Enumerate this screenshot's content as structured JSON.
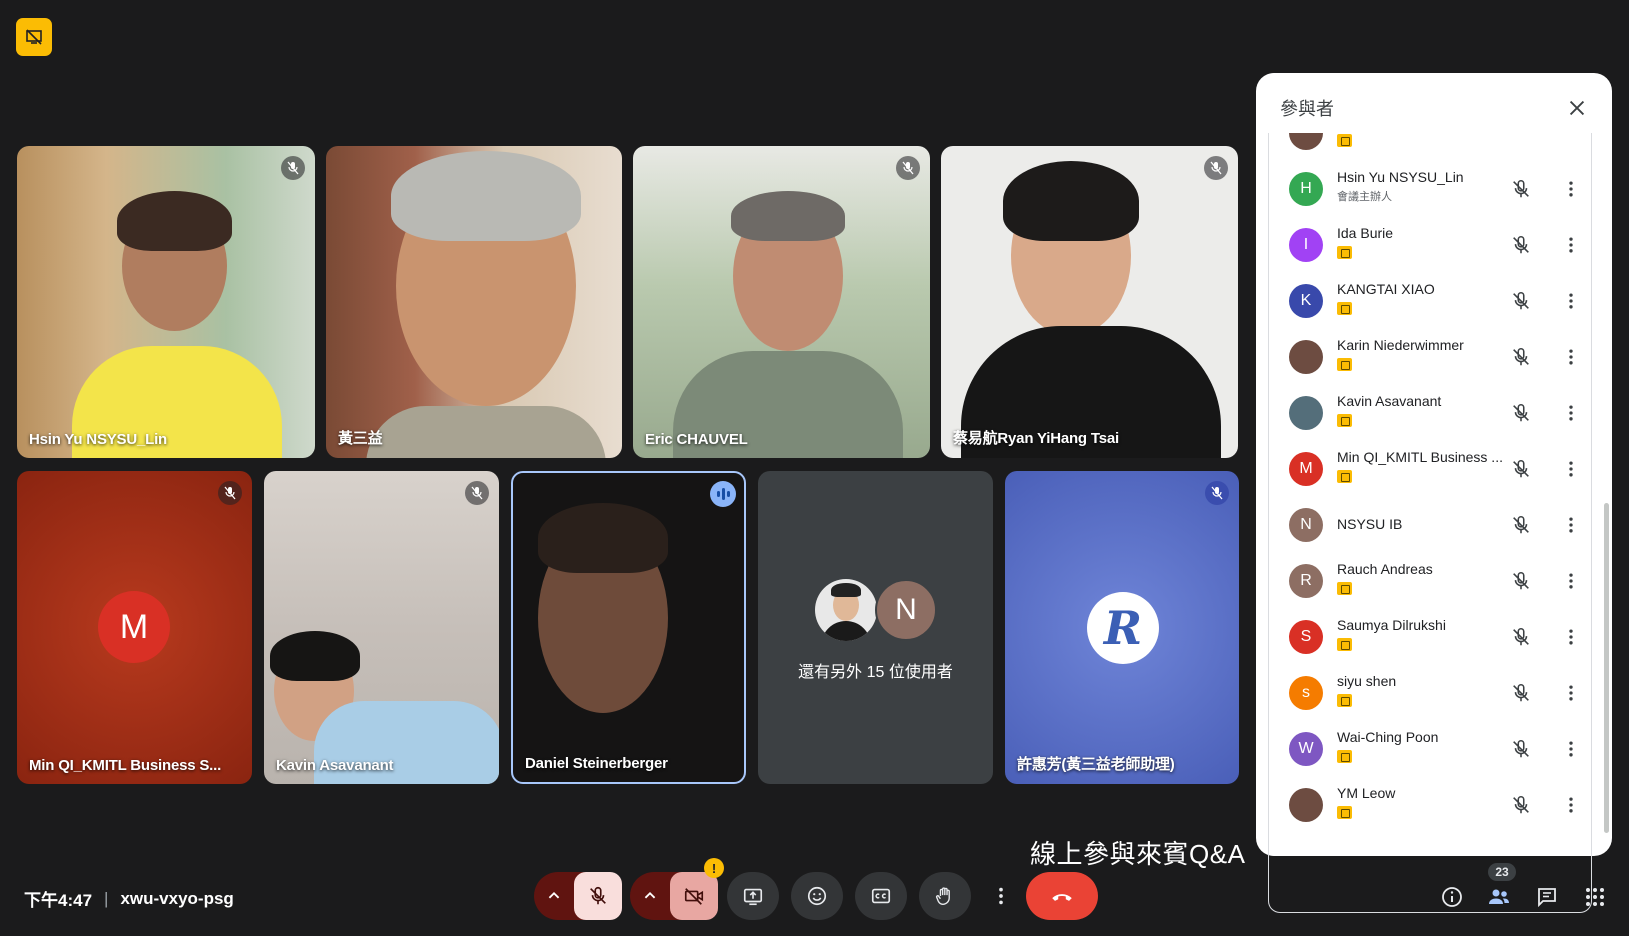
{
  "meeting": {
    "time": "下午4:47",
    "code": "xwu-vxyo-psg",
    "caption": "線上參與來賓Q&A",
    "participant_count": "23"
  },
  "tiles": [
    {
      "name": "Hsin Yu NSYSU_Lin"
    },
    {
      "name": "黃三益"
    },
    {
      "name": "Eric CHAUVEL"
    },
    {
      "name": "蔡易航Ryan YiHang Tsai"
    },
    {
      "name": "Min QI_KMITL Business S...",
      "initial": "M"
    },
    {
      "name": "Kavin Asavanant"
    },
    {
      "name": "Daniel Steinerberger"
    },
    {
      "others_text": "還有另外 15 位使用者",
      "initial": "N"
    },
    {
      "name": "許惠芳(黃三益老師助理)",
      "logo": "R"
    }
  ],
  "panel": {
    "title": "參與者",
    "people": [
      {
        "name": "Hsin Yu NSYSU_Lin",
        "role": "會議主辦人",
        "initial": "H",
        "color": "#34a853"
      },
      {
        "name": "Ida Burie",
        "initial": "I",
        "color": "#a142f4"
      },
      {
        "name": "KANGTAI XIAO",
        "initial": "K",
        "color": "#3949ab"
      },
      {
        "name": "Karin Niederwimmer",
        "initial": "",
        "color": "#6d4c41"
      },
      {
        "name": "Kavin Asavanant",
        "initial": "",
        "color": "#546e7a"
      },
      {
        "name": "Min QI_KMITL Business ...",
        "initial": "M",
        "color": "#d93025"
      },
      {
        "name": "NSYSU IB",
        "initial": "N",
        "color": "#8d6e63"
      },
      {
        "name": "Rauch Andreas",
        "initial": "R",
        "color": "#8d6e63"
      },
      {
        "name": "Saumya Dilrukshi",
        "initial": "S",
        "color": "#d93025"
      },
      {
        "name": "siyu shen",
        "initial": "s",
        "color": "#f57c00"
      },
      {
        "name": "Wai-Ching Poon",
        "initial": "W",
        "color": "#7e57c2"
      },
      {
        "name": "YM Leow",
        "initial": "",
        "color": "#6d4c41"
      }
    ]
  },
  "icons": {
    "top_badge": "presentation-off-icon",
    "mic": "mic-off-icon",
    "camera": "camera-off-icon",
    "present": "present-screen-icon",
    "emoji": "emoji-icon",
    "captions": "captions-icon",
    "hand": "raise-hand-icon",
    "more": "more-vert-icon",
    "leave": "end-call-icon",
    "info": "info-icon",
    "people": "people-icon",
    "chat": "chat-icon",
    "activities": "apps-grid-icon"
  },
  "colors": {
    "accent_yellow": "#fbbc04",
    "end_call_red": "#ea4335",
    "mic_off_bg": "#f9dedc",
    "speaking_blue": "#8ab4f8"
  }
}
